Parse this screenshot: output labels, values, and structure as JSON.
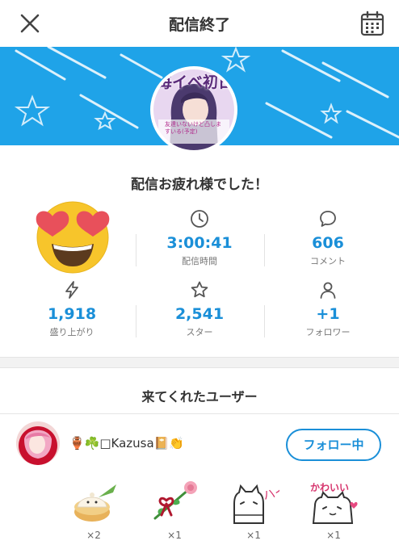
{
  "header": {
    "title": "配信終了",
    "close_icon": "close-icon",
    "calendar_icon": "calendar-icon"
  },
  "banner": {
    "overlay_text": "毎イベ初日",
    "overlay_caption": "友達いないけど凸しますいる(予定)"
  },
  "summary": {
    "message": "配信お疲れ様でした！"
  },
  "stats": [
    {
      "icon": "clock-icon",
      "value": "3:00:41",
      "label": "配信時間"
    },
    {
      "icon": "comment-icon",
      "value": "606",
      "label": "コメント"
    },
    {
      "icon": "lightning-icon",
      "value": "1,918",
      "label": "盛り上がり"
    },
    {
      "icon": "star-icon",
      "value": "2,541",
      "label": "スター"
    },
    {
      "icon": "person-icon",
      "value": "+1",
      "label": "フォロワー"
    }
  ],
  "visitors": {
    "title": "来てくれたユーザー",
    "user": {
      "name": "🏺☘️□Kazusa📔👏",
      "follow_label": "フォロー中"
    },
    "gifts": [
      {
        "icon": "dumpling-icon",
        "count": "×2"
      },
      {
        "icon": "rose-icon",
        "count": "×1"
      },
      {
        "icon": "cat-hai-icon",
        "count": "×1",
        "text": "ハイ!"
      },
      {
        "icon": "cat-kawaii-icon",
        "count": "×1",
        "text": "かわいい"
      }
    ]
  },
  "colors": {
    "accent": "#1a8fd8",
    "banner": "#1fa3e8"
  }
}
